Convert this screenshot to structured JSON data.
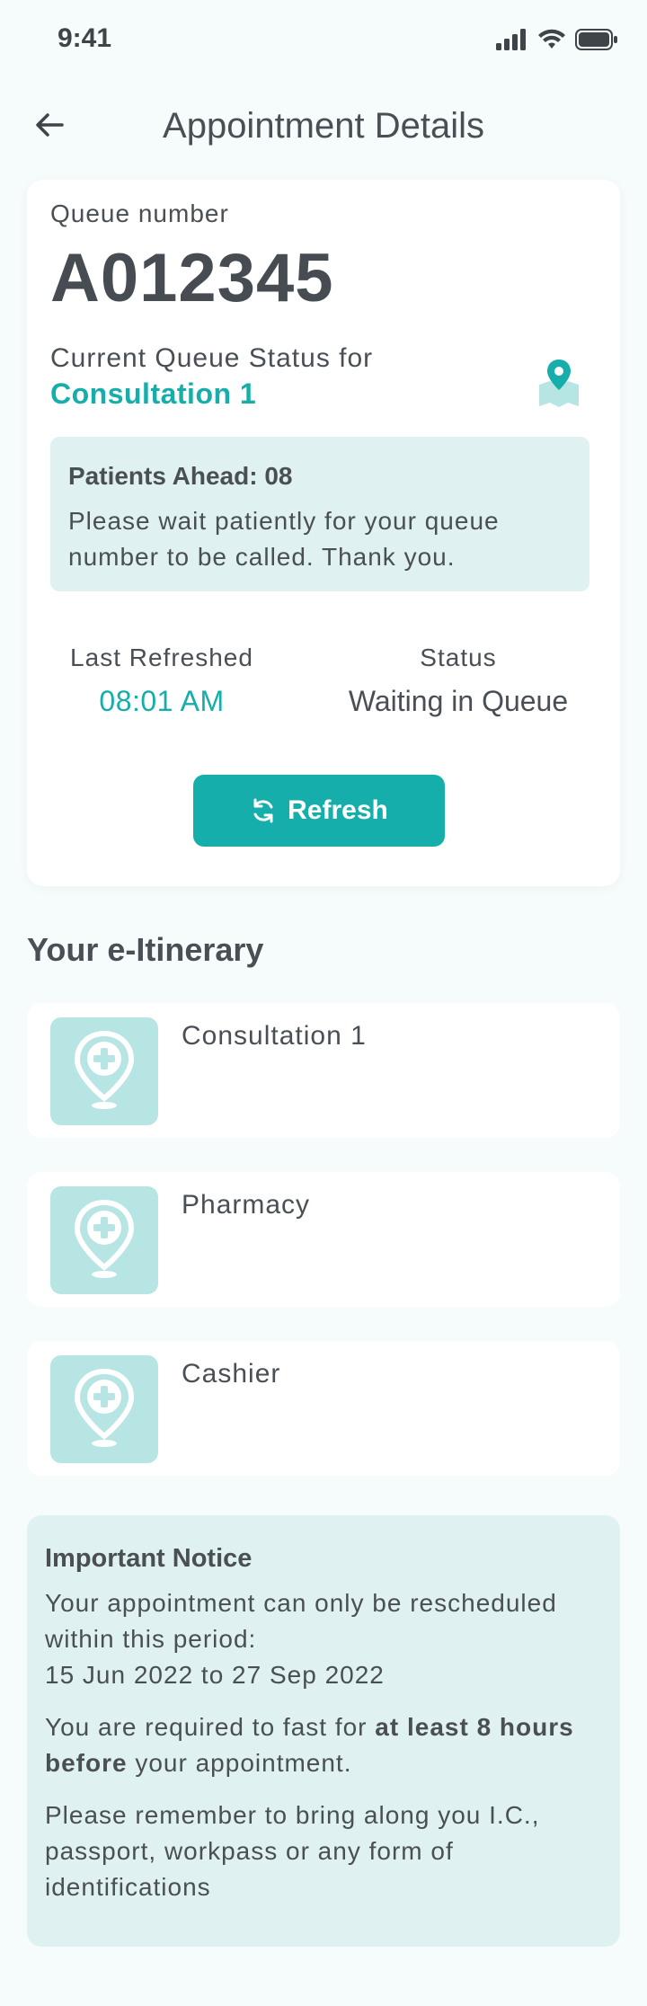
{
  "status_bar": {
    "time": "9:41"
  },
  "header": {
    "title": "Appointment Details"
  },
  "queue_card": {
    "queue_label": "Queue number",
    "queue_number": "A012345",
    "status_for_label": "Current Queue Status for",
    "status_location": "Consultation 1",
    "patients_ahead": "Patients Ahead: 08",
    "wait_message": "Please wait patiently for your queue number to be called. Thank you.",
    "last_refreshed_label": "Last Refreshed",
    "last_refreshed_value": "08:01 AM",
    "status_label": "Status",
    "status_value": "Waiting in Queue",
    "refresh_label": "Refresh"
  },
  "itinerary": {
    "title": "Your e-Itinerary",
    "items": [
      {
        "label": "Consultation 1"
      },
      {
        "label": "Pharmacy"
      },
      {
        "label": "Cashier"
      }
    ]
  },
  "notice": {
    "title": "Important Notice",
    "reschedule_text": "Your appointment can only be rescheduled within this period:",
    "period": "15 Jun 2022 to 27 Sep 2022",
    "fast_prefix": "You are required to fast for ",
    "fast_bold": "at least 8 hours before",
    "fast_suffix": " your appointment.",
    "bring_text": "Please remember to bring along you I.C., passport, workpass or any form of identifications"
  },
  "colors": {
    "accent": "#16aeaa",
    "icon_bg": "#b7e5e4",
    "notice_bg": "#dff2f1",
    "text": "#4a4f55"
  },
  "icons": {
    "back": "arrow-left-icon",
    "map": "map-pin-icon",
    "refresh": "refresh-icon",
    "itinerary": "medical-location-icon"
  }
}
